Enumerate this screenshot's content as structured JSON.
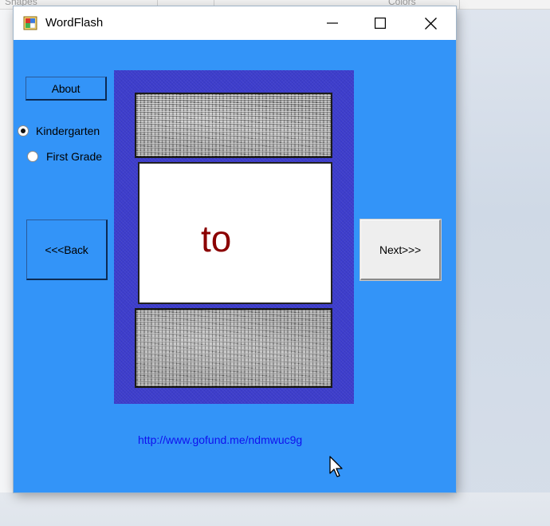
{
  "background": {
    "labels": [
      "Shapes",
      "Colors"
    ]
  },
  "window": {
    "title": "WordFlash",
    "icon": "app-icon",
    "controls": [
      "minimize-icon",
      "maximize-icon",
      "close-icon"
    ]
  },
  "buttons": {
    "about": "About",
    "back": "<<<Back",
    "next": "Next>>>"
  },
  "grade_options": [
    {
      "label": "Kindergarten",
      "selected": true
    },
    {
      "label": "First Grade",
      "selected": false
    }
  ],
  "card": {
    "word": "to"
  },
  "link": "http://www.gofund.me/ndmwuc9g",
  "colors": {
    "form_background": "#3394f8",
    "card_border": "#3d3dcc",
    "word_color": "#8b0000",
    "link_color": "#1010ee"
  }
}
